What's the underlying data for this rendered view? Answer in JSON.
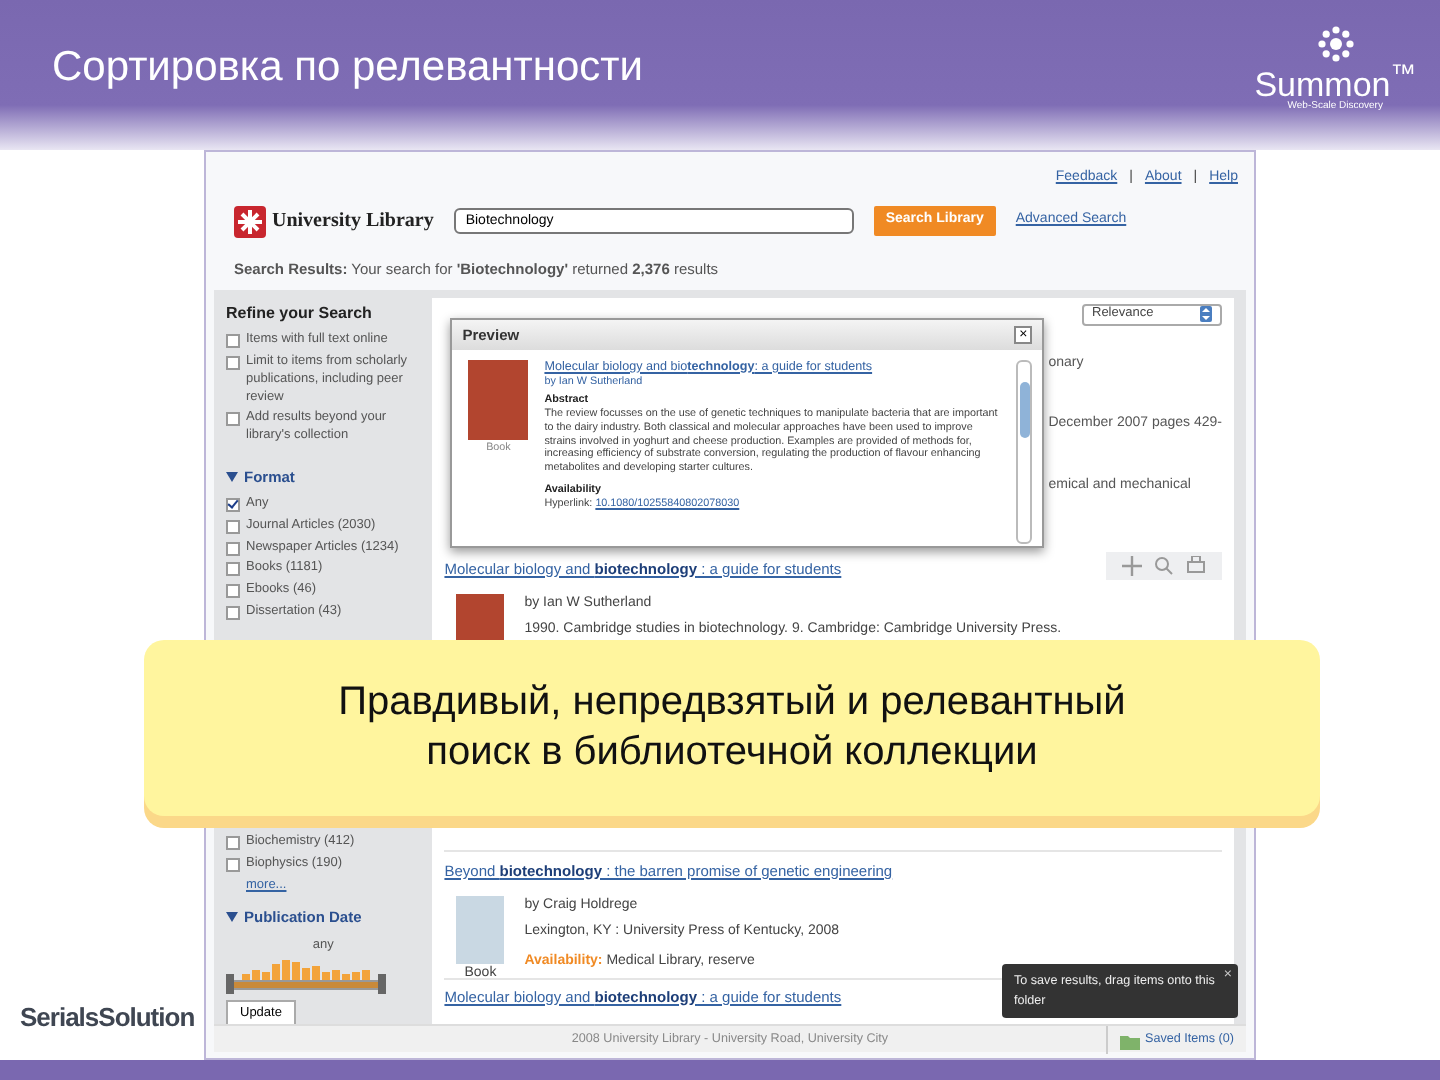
{
  "slide": {
    "title": "Сортировка по релевантности",
    "brand": "Summon",
    "brand_tm": "™",
    "brand_tagline": "Web-Scale Discovery",
    "footer_logo": "SerialsSolution"
  },
  "callout": {
    "text": "Правдивый, непредвзятый и релевантный поиск в библиотечной коллекции"
  },
  "page": {
    "top_links": [
      {
        "kind": "link",
        "label": "Feedback"
      },
      {
        "kind": "separator",
        "label": "|"
      },
      {
        "kind": "link",
        "label": "About"
      },
      {
        "kind": "separator",
        "label": "|"
      },
      {
        "kind": "link",
        "label": "Help"
      }
    ],
    "logo": "University Library",
    "search": {
      "value": "Biotechnology",
      "button": "Search Library",
      "advanced": "Advanced Search"
    },
    "summary": "**Search Results:** Your search for **'Biotechnology'** returned **2,376** results",
    "sidebar": {
      "title": "Refine your Search",
      "filters": [
        {
          "label": "Items with full text online",
          "checked": false
        },
        {
          "label": "Limit to items from scholarly publications, including peer review",
          "checked": false
        },
        {
          "label": "Add results beyond your library's collection",
          "checked": false
        }
      ],
      "format": {
        "title": "Format",
        "expanded": true,
        "items": [
          {
            "label": "Any",
            "checked": true
          },
          {
            "label": "Journal Articles",
            "count": "(2030)",
            "checked": false
          },
          {
            "label": "Newspaper Articles",
            "count": "(1234)",
            "checked": false
          },
          {
            "label": "Books",
            "count": "(1181)",
            "checked": false
          },
          {
            "label": "Ebooks",
            "count": "(46)",
            "checked": false
          },
          {
            "label": "Dissertation",
            "count": "(43)",
            "checked": false
          }
        ]
      },
      "facet_2": {
        "items": [
          {
            "label": "Biochemistry",
            "count": "(412)",
            "checked": false
          },
          {
            "label": "Biophysics",
            "count": "(190)",
            "checked": false
          }
        ],
        "more": "more..."
      },
      "date": {
        "title": "Publication Date",
        "expanded": true,
        "value": "any",
        "level": 1,
        "button": "Update"
      }
    },
    "sort": {
      "value": "Relevance"
    },
    "background_fragments": [
      "onary",
      "December 2007 pages 429-",
      "emical and mechanical"
    ],
    "results": [
      {
        "title": "Molecular biology and **biotechnology** : a guide for students",
        "author": "by Ian W Sutherland",
        "details": "1990. Cambridge studies in biotechnology. 9. Cambridge: Cambridge University Press."
      },
      {
        "title": "Beyond **biotechnology** : the barren promise of genetic engineering",
        "author": "by Craig Holdrege",
        "details": "Lexington, KY : University Press of Kentucky, 2008",
        "availability_label": "Availability:",
        "availability": "Medical Library, reserve",
        "format": "Book"
      },
      {
        "title": "Molecular biology and **biotechnology** : a guide for students"
      }
    ],
    "preview": {
      "title": "Preview",
      "close": "×",
      "cover_label": "Book",
      "result_title": "Molecular biology and bio**technology**: a guide for students",
      "author": "by Ian W Sutherland",
      "abstract_heading": "Abstract",
      "abstract": "The review focusses on the use of genetic techniques to manipulate bacteria that are important to the dairy industry. Both classical and molecular approaches have been used to improve strains involved in yoghurt and cheese production. Examples are provided of methods for, increasing efficiency of substrate conversion, regulating the production of flavour enhancing metabolites and developing starter cultures.",
      "availability_heading": "Availability",
      "hyperlink_label": "Hyperlink:",
      "hyperlink": "10.1080/10255840802078030"
    },
    "tooltip": {
      "text": "To save results, drag items onto this folder",
      "close": "×"
    },
    "footer": {
      "text": "2008 University Library - University Road, University City",
      "saved": "Saved Items (0)"
    }
  }
}
